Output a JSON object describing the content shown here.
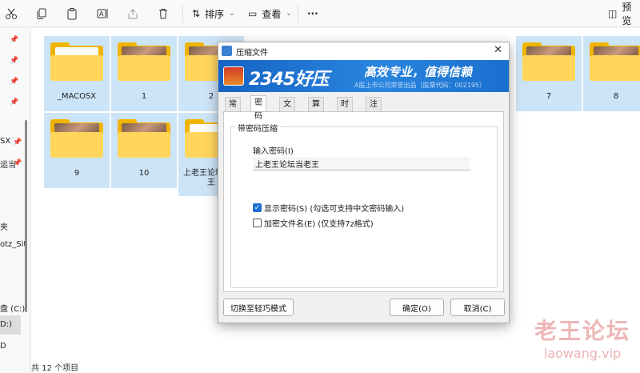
{
  "toolbar": {
    "sort_label": "排序",
    "view_label": "查看",
    "more_label": "···",
    "preview_label": "预览"
  },
  "nav": {
    "labels": [
      "SX",
      "运当",
      "夹",
      "otz_Sit",
      "盘 (C:)",
      "D:)",
      "D"
    ]
  },
  "folders": [
    {
      "name": "_MACOSX",
      "thumb": "empty"
    },
    {
      "name": "1",
      "thumb": "photo"
    },
    {
      "name": "2",
      "thumb": "photo"
    },
    {
      "name": "7",
      "thumb": "photo"
    },
    {
      "name": "8",
      "thumb": "photo"
    },
    {
      "name": "9",
      "thumb": "photo"
    },
    {
      "name": "10",
      "thumb": "photo"
    },
    {
      "name": "上老王论坛当老王",
      "thumb": "empty"
    }
  ],
  "status": {
    "text": "共 12 个项目"
  },
  "dialog": {
    "title": "压缩文件",
    "close": "✕",
    "brand": "2345好压",
    "slogan": "高效专业，值得信赖",
    "sub": "A股上市公司荣誉出品（股票代码：002195）",
    "tabs": [
      "常规",
      "密码",
      "文件",
      "算法",
      "时间",
      "注释"
    ],
    "active_tab": "密码",
    "group_title": "带密码压缩",
    "password_label": "输入密码(I)",
    "password_value": "上老王论坛当老王",
    "show_password_label": "显示密码(S)  (勾选可支持中文密码输入)",
    "show_password_checked": true,
    "encrypt_names_label": "加密文件名(E)  (仅支持7z格式)",
    "encrypt_names_checked": false,
    "quick_mode_button": "切换至轻巧模式",
    "ok_button": "确定(O)",
    "cancel_button": "取消(C)"
  },
  "watermark": {
    "line1": "老王论坛",
    "line2": "laowang.vip"
  }
}
